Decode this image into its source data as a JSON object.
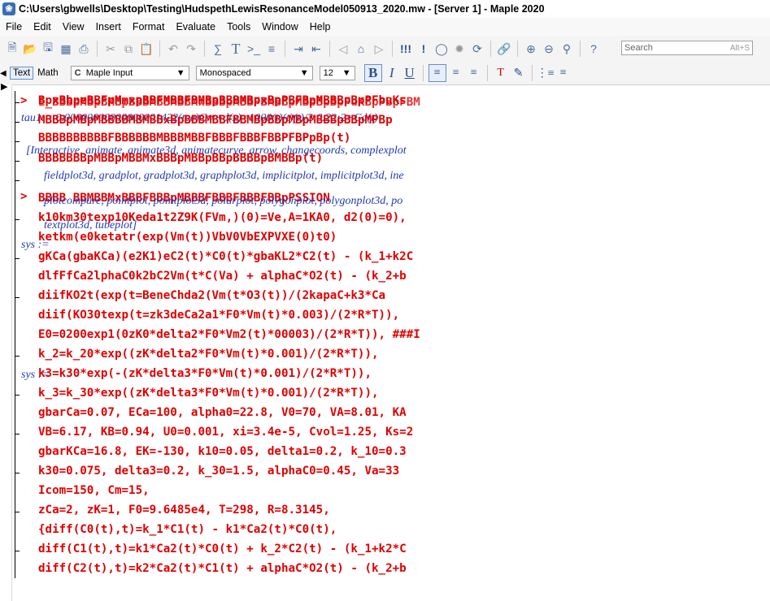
{
  "window": {
    "title": "C:\\Users\\gbwells\\Desktop\\Testing\\HudspethLewisResonanceModel050913_2020.mw - [Server 1] - Maple 2020",
    "app_icon": "maple-leaf-icon"
  },
  "menu": [
    "File",
    "Edit",
    "View",
    "Insert",
    "Format",
    "Evaluate",
    "Tools",
    "Window",
    "Help"
  ],
  "toolbar": {
    "search_placeholder": "Search",
    "search_shortcut": "Alt+S",
    "icons": [
      "new-document-icon",
      "open-icon",
      "save-icon",
      "save-all-icon",
      "print-icon",
      "cut-icon",
      "copy-icon",
      "paste-icon",
      "undo-icon",
      "redo-icon",
      "insert-math-icon",
      "insert-text-icon",
      "insert-prompt-icon",
      "execution-group-icon",
      "indent-icon",
      "outdent-icon",
      "back-icon",
      "home-icon",
      "forward-icon",
      "execute-all-icon",
      "execute-icon",
      "stop-icon",
      "debug-icon",
      "restart-icon",
      "link-icon",
      "zoom-in-icon",
      "zoom-out-icon",
      "zoom-reset-icon",
      "help-icon"
    ]
  },
  "format": {
    "text_tab": "Text",
    "math_tab": "Math",
    "style": "Maple Input",
    "style_prefix": "C",
    "font": "Monospaced",
    "size": "12",
    "bold": "B",
    "italic": "I",
    "underline": "U"
  },
  "document": {
    "prompt_char": ">",
    "overlapping_code_lines": [
      "BpxBbpeBBFpMmxpBBFMBBFBMBpBBBMBpxBpPBFBpMBBBpBpPFbuKs",
      "E_BBBpMBpBMBpBBBMBBMBBMxBBBpMBBFBMBBpMBpBpBpFuKBpPBpFBM",
      "MBBBpMBpMBBBBMBMBBxBpBBBMBBFBBMBpBBpMBpMBBBpBBpMPBp",
      "BBBBBBBBBBFBBBBBBMBBBMBBFBBBFBBBFBBPFBPpBp(t)",
      "BBBBBBBpMBBpMBBMxBBBpMBBpBBpBBBBpBMBBp(t)",
      "BBBB BBMBBMxBBBFBBBpMBBBFBBBFBBBFBBpPSSION",
      "k10km30texp10Keda1t2Z9K(FVm,)(0)=Ve,A=1KA0, d2(0)=0),",
      "ketkm(e0ketatr(exp(Vm(t))VbV0VbEXPVXE(0)t0)",
      "gKCa(gbaKCa)(e2K1)eC2(t)*C0(t)*gbaKL2*C2(t) - (k_1+k2C",
      "dlfFfCa2lphaC0k2bC2Vm(t*C(Va) + alphaC*O2(t) - (k_2+b",
      "diifKO2t(exp(t=BeneChda2(Vm(t*O3(t))/(2kapaC+k3*Ca",
      "diif(KO30texp(t=zk3deCa2a1*F0*Vm(t)*0.003)/(2*R*T)),",
      "E0=0200exp1(0zK0*delta2*F0*Vm2(t)*00003)/(2*R*T)), ###I"
    ],
    "code_lines": [
      "k_2=k_20*exp((zK*delta2*F0*Vm(t)*0.001)/(2*R*T)),",
      "k3=k30*exp(-(zK*delta3*F0*Vm(t)*0.001)/(2*R*T)),",
      "k_3=k_30*exp((zK*delta3*F0*Vm(t)*0.001)/(2*R*T)),",
      "gbarCa=0.07, ECa=100, alpha0=22.8, V0=70, VA=8.01, KA",
      "VB=6.17, KB=0.94, U0=0.001, xi=3.4e-5, Cvol=1.25, Ks=2",
      "gbarKCa=16.8, EK=-130, k10=0.05, delta1=0.2, k_10=0.3",
      "k30=0.075, delta3=0.2, k_30=1.5, alphaC0=0.45, Va=33",
      "Icom=150, Cm=15,",
      "zCa=2, zK=1, F0=9.6485e4, T=298, R=8.3145,",
      "{diff(C0(t),t)=k_1*C1(t) - k1*Ca2(t)*C0(t),",
      "diff(C1(t),t)=k1*Ca2(t)*C0(t) + k_2*C2(t) - (k_1+k2*C",
      "diff(C2(t),t)=k2*Ca2(t)*C1(t) + alphaC*O2(t) - (k_2+b"
    ],
    "output_fragments": [
      "tau1:= 0.00000000000000001422(tee)C:x+d(x)=1000(t)(t)(t)/2:0.22:2+Cd(t)",
      "[Interactive, animate, animate3d, animatecurve, arrow, changecoords, complexplot",
      "fieldplot3d, gradplot, gradplot3d, graphplot3d, implicitplot, implicitplot3d, ine",
      "plotcompare, pointplot, pointplot3d, polarplot, polygonplot, polygonplot3d, po",
      "textplot3d, tubeplot]",
      "sys :=",
      "sys :="
    ]
  }
}
